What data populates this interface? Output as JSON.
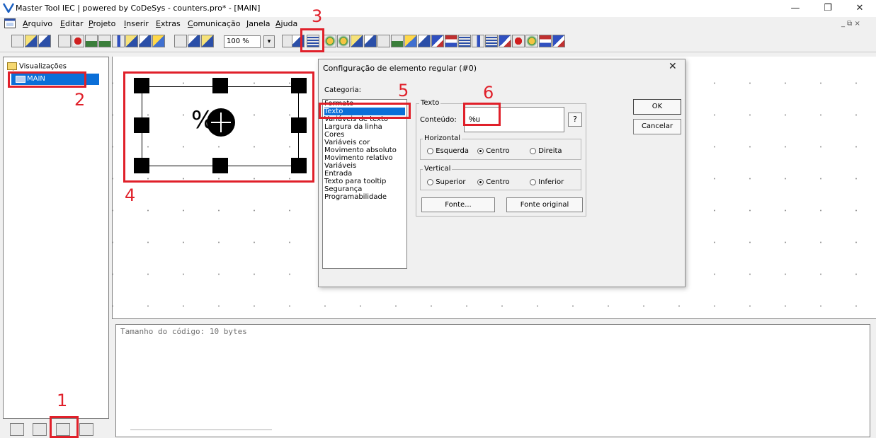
{
  "window": {
    "title": "Master Tool IEC | powered by CoDeSys - counters.pro* - [MAIN]",
    "minimize_glyph": "—",
    "maximize_glyph": "❐",
    "close_glyph": "✕"
  },
  "menu": {
    "items": [
      "Arquivo",
      "Editar",
      "Projeto",
      "Inserir",
      "Extras",
      "Comunicação",
      "Janela",
      "Ajuda"
    ],
    "mdi_buttons": "_ ⧉ ×"
  },
  "toolbar": {
    "zoom": "100 %",
    "zoom_arrow": "▾"
  },
  "tree": {
    "root_label": "Visualizações",
    "item_label": "MAIN"
  },
  "canvas": {
    "element_text": "%u"
  },
  "dialog": {
    "title": "Configuração de elemento regular (#0)",
    "close_glyph": "✕",
    "category_label": "Categoria:",
    "categories": [
      "Formato",
      "Texto",
      "Variáveis de texto",
      "Largura da linha",
      "Cores",
      "Variáveis cor",
      "Movimento absoluto",
      "Movimento relativo",
      "Variáveis",
      "Entrada",
      "Texto para tooltip",
      "Segurança",
      "Programabilidade"
    ],
    "selected_category": "Texto",
    "text_group": "Texto",
    "content_label": "Conteúdo:",
    "content_value": "%u",
    "help_label": "?",
    "horizontal_group": "Horizontal",
    "horizontal_options": [
      "Esquerda",
      "Centro",
      "Direita"
    ],
    "vertical_group": "Vertical",
    "vertical_options": [
      "Superior",
      "Centro",
      "Inferior"
    ],
    "font_button": "Fonte...",
    "original_font_button": "Fonte original",
    "ok_button": "OK",
    "cancel_button": "Cancelar"
  },
  "messages": {
    "code_size": "Tamanho do código: 10 bytes"
  },
  "annotations": [
    "1",
    "2",
    "3",
    "4",
    "5",
    "6"
  ],
  "colors": {
    "annotation": "#e0202a",
    "selection": "#0b6fd8"
  }
}
